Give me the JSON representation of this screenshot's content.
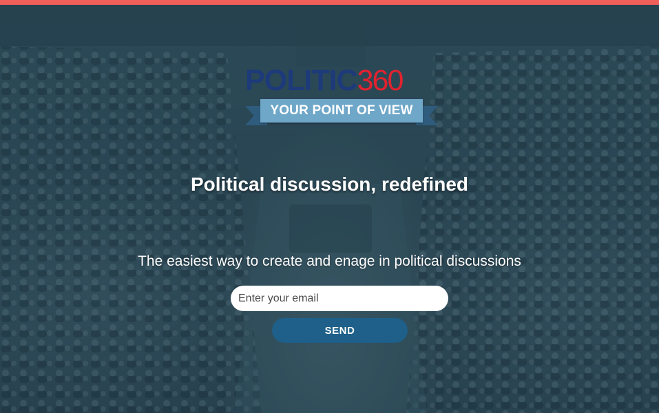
{
  "brand": {
    "logo_word": "POLITIC",
    "logo_number": "360",
    "tagline": "YOUR POINT OF VIEW",
    "colors": {
      "accent_bar": "#f15f5a",
      "logo_word": "#1d3a7a",
      "logo_number": "#e0232f",
      "ribbon": "#6fa7c8",
      "button": "#1e6089"
    }
  },
  "hero": {
    "headline": "Political discussion, redefined",
    "subheadline": "The easiest way to create and enage in political discussions",
    "background": "parliament-chamber-photo"
  },
  "signup": {
    "email_placeholder": "Enter your email",
    "email_value": "",
    "send_label": "SEND"
  }
}
